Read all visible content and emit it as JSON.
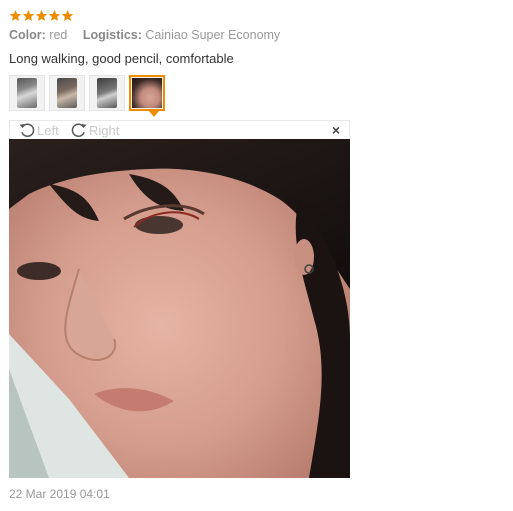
{
  "review": {
    "rating": 5,
    "rating_max": 5,
    "star_color": "#f08c00",
    "color_label": "Color:",
    "color_value": "red",
    "logistics_label": "Logistics:",
    "logistics_value": "Cainiao Super Economy",
    "text": "Long walking, good pencil, comfortable",
    "date": "22 Mar 2019 04:01"
  },
  "thumbnails": [
    {
      "icon": "photo-thumbnail",
      "active": false
    },
    {
      "icon": "photo-thumbnail",
      "active": false
    },
    {
      "icon": "photo-thumbnail",
      "active": false
    },
    {
      "icon": "photo-thumbnail",
      "active": true
    }
  ],
  "viewer": {
    "left_label": "Left",
    "right_label": "Right",
    "close_glyph": "×",
    "left_icon": "rotate-left-icon",
    "right_icon": "rotate-right-icon",
    "close_icon": "close-icon"
  },
  "colors": {
    "accent": "#f08c00",
    "muted_text": "#999999"
  }
}
